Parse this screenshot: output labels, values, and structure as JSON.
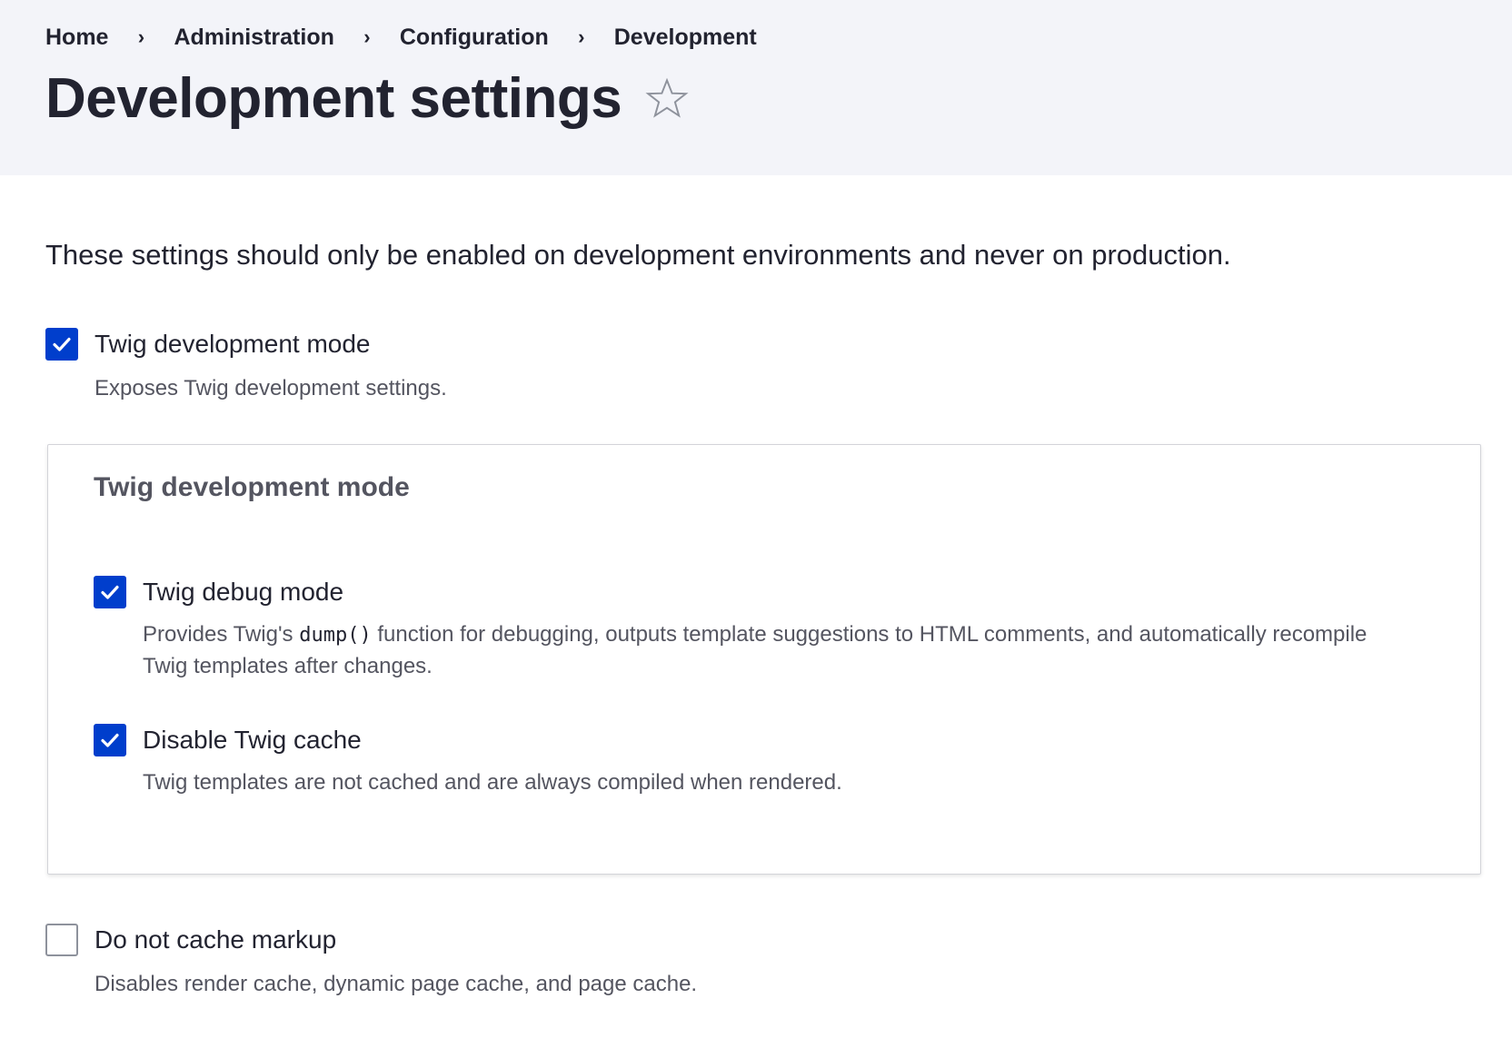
{
  "breadcrumb": {
    "items": [
      "Home",
      "Administration",
      "Configuration",
      "Development"
    ],
    "separator": "›"
  },
  "page": {
    "title": "Development settings",
    "favorite_icon": "star-outline-icon"
  },
  "intro": "These settings should only be enabled on development environments and never on production.",
  "twig_dev_mode": {
    "label": "Twig development mode",
    "checked": true,
    "description": "Exposes Twig development settings."
  },
  "fieldset": {
    "legend": "Twig development mode",
    "debug": {
      "label": "Twig debug mode",
      "checked": true,
      "description_before": "Provides Twig's ",
      "description_code": "dump()",
      "description_after": " function for debugging, outputs template suggestions to HTML comments, and automatically recompile Twig templates after changes."
    },
    "cache": {
      "label": "Disable Twig cache",
      "checked": true,
      "description": "Twig templates are not cached and are always compiled when rendered."
    }
  },
  "no_cache_markup": {
    "label": "Do not cache markup",
    "checked": false,
    "description": "Disables render cache, dynamic page cache, and page cache."
  },
  "colors": {
    "accent": "#003ecc",
    "header_bg": "#f3f4f9",
    "text": "#222330",
    "muted": "#545560"
  }
}
